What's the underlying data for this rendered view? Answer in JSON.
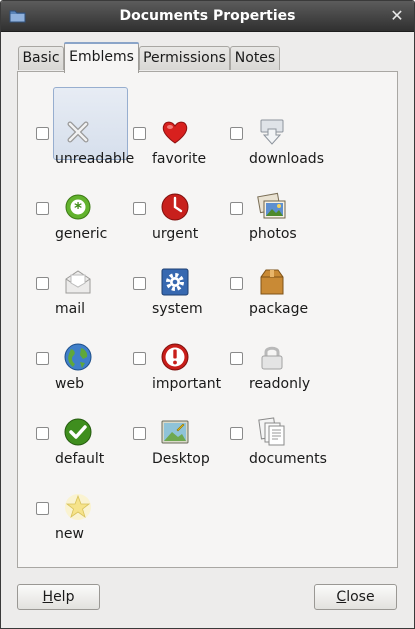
{
  "window": {
    "title": "Documents Properties"
  },
  "tabs": [
    {
      "label": "Basic"
    },
    {
      "label": "Emblems"
    },
    {
      "label": "Permissions"
    },
    {
      "label": "Notes"
    }
  ],
  "active_tab": "Emblems",
  "emblems": [
    {
      "label": "unreadable",
      "icon": "x-icon",
      "checked": false
    },
    {
      "label": "favorite",
      "icon": "heart-icon",
      "checked": false
    },
    {
      "label": "downloads",
      "icon": "download-icon",
      "checked": false
    },
    {
      "label": "generic",
      "icon": "asterisk-icon",
      "checked": false
    },
    {
      "label": "urgent",
      "icon": "clock-icon",
      "checked": false
    },
    {
      "label": "photos",
      "icon": "photo-icon",
      "checked": false
    },
    {
      "label": "mail",
      "icon": "envelope-icon",
      "checked": false
    },
    {
      "label": "system",
      "icon": "gear-icon",
      "checked": false
    },
    {
      "label": "package",
      "icon": "package-icon",
      "checked": false
    },
    {
      "label": "web",
      "icon": "globe-icon",
      "checked": false
    },
    {
      "label": "important",
      "icon": "exclamation-icon",
      "checked": false
    },
    {
      "label": "readonly",
      "icon": "lock-icon",
      "checked": false
    },
    {
      "label": "default",
      "icon": "checkmark-icon",
      "checked": false
    },
    {
      "label": "Desktop",
      "icon": "desktop-icon",
      "checked": false
    },
    {
      "label": "documents",
      "icon": "documents-icon",
      "checked": false
    },
    {
      "label": "new",
      "icon": "star-icon",
      "checked": false
    }
  ],
  "selected_emblem": "unreadable",
  "buttons": {
    "help": {
      "label": "Help",
      "mnemonic": "H"
    },
    "close": {
      "label": "Close",
      "mnemonic": "C"
    }
  },
  "colors": {
    "titlebar": "#3c3c3c",
    "window_bg": "#edeceb",
    "selection": "#d6dfec"
  }
}
